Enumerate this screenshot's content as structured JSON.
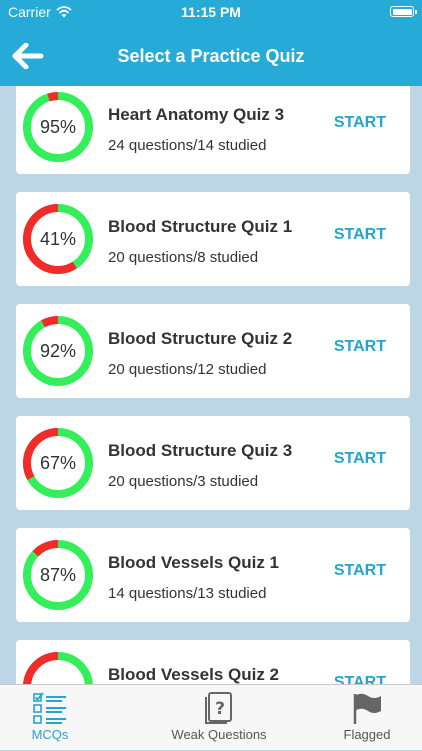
{
  "status_bar": {
    "carrier": "Carrier",
    "time": "11:15 PM"
  },
  "nav": {
    "title": "Select a Practice Quiz"
  },
  "quizzes": [
    {
      "percent": 95,
      "percent_label": "95%",
      "title": "Heart Anatomy Quiz 3",
      "subtitle": "24 questions/14 studied",
      "action": "START"
    },
    {
      "percent": 41,
      "percent_label": "41%",
      "title": "Blood Structure Quiz 1",
      "subtitle": "20 questions/8 studied",
      "action": "START"
    },
    {
      "percent": 92,
      "percent_label": "92%",
      "title": "Blood Structure Quiz 2",
      "subtitle": "20 questions/12 studied",
      "action": "START"
    },
    {
      "percent": 67,
      "percent_label": "67%",
      "title": "Blood Structure Quiz 3",
      "subtitle": "20 questions/3 studied",
      "action": "START"
    },
    {
      "percent": 87,
      "percent_label": "87%",
      "title": "Blood Vessels Quiz 1",
      "subtitle": "14 questions/13 studied",
      "action": "START"
    },
    {
      "percent": 60,
      "percent_label": "",
      "title": "Blood Vessels Quiz 2",
      "subtitle": "",
      "action": "START"
    }
  ],
  "tabs": [
    {
      "label": "MCQs",
      "icon": "checklist-icon",
      "active": true
    },
    {
      "label": "Weak Questions",
      "icon": "question-doc-icon",
      "active": false
    },
    {
      "label": "Flagged",
      "icon": "flag-icon",
      "active": false
    }
  ],
  "colors": {
    "header": "#26abd9",
    "accent": "#26a4cf",
    "ring_good": "#33f05a",
    "ring_bad": "#f22a2a",
    "background": "#bcd6e6"
  }
}
